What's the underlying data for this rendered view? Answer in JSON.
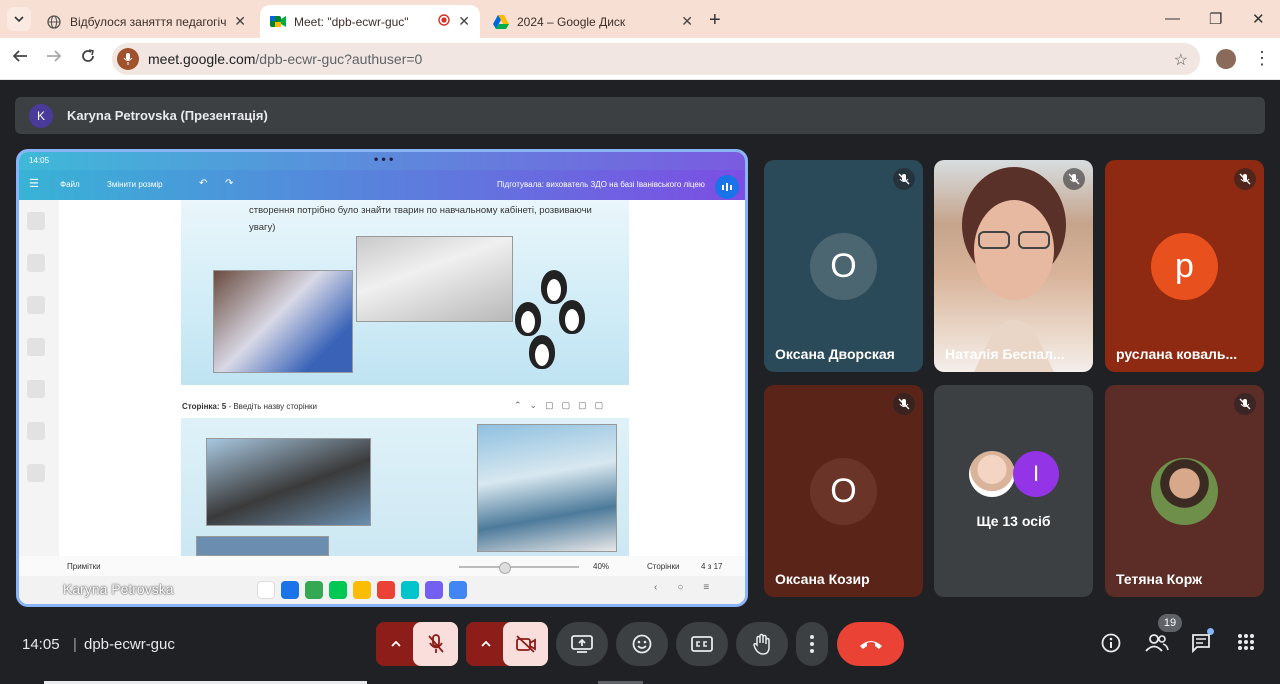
{
  "browser": {
    "tabs": [
      {
        "title": "Відбулося заняття педагогічно",
        "active": false
      },
      {
        "title": "Meet: \"dpb-ecwr-guc\"",
        "active": true
      },
      {
        "title": "2024 – Google Диск",
        "active": false
      }
    ],
    "close_glyph": "✕",
    "new_tab_glyph": "+",
    "window_controls": [
      "—",
      "❐",
      "✕"
    ],
    "url_host": "meet.google.com",
    "url_path": "/dpb-ecwr-guc?authuser=0"
  },
  "meet": {
    "presenter": {
      "initial": "K",
      "label": "Karyna Petrovska (Презентація)"
    },
    "shared_screen": {
      "status_time": "14:05",
      "toolbar_file": "Файл",
      "toolbar_resize": "Змінити розмір",
      "toolbar_prepared": "Підготувала: вихователь ЗДО на базі Іванівського ліцею",
      "slide_text": "створення потрібно було знайти тварин по навчальному кабінеті, розвиваючи увагу)",
      "page_label_bold": "Сторінка: 5",
      "page_label_rest": " - Введіть назву сторінки",
      "notes_label": "Примітки",
      "zoom": "40%",
      "pages_label": "Сторінки",
      "page_count": "4 з 17",
      "dock_name": "Karyna Petrovska"
    },
    "participants": [
      {
        "name": "Оксана Дворская",
        "initial": "О",
        "bg": "#2a4a59",
        "avatar_bg": "#4b6571",
        "muted": true
      },
      {
        "name": "Наталія Беспал...",
        "initial": "",
        "bg": "#cfd8dc",
        "avatar_bg": "",
        "muted": true
      },
      {
        "name": "руслана коваль...",
        "initial": "р",
        "bg": "#8e2a12",
        "avatar_bg": "#e8501e",
        "muted": true
      },
      {
        "name": "Оксана Козир",
        "initial": "О",
        "bg": "#5a2418",
        "avatar_bg": "#6b3429",
        "muted": true
      },
      {
        "name": "Тетяна Корж",
        "initial": "",
        "bg": "#5c2c26",
        "avatar_bg": "",
        "muted": true
      }
    ],
    "more_tile": {
      "label": "Ще 13 осіб",
      "initial": "І"
    },
    "time": "14:05",
    "meeting_code": "dpb-ecwr-guc",
    "people_count": "19"
  },
  "colors": {
    "mic_off_red": "#f9dedc",
    "mic_off_dark": "#8c1d18",
    "end_call": "#ea4335",
    "accent_blue": "#8ab4f8"
  }
}
